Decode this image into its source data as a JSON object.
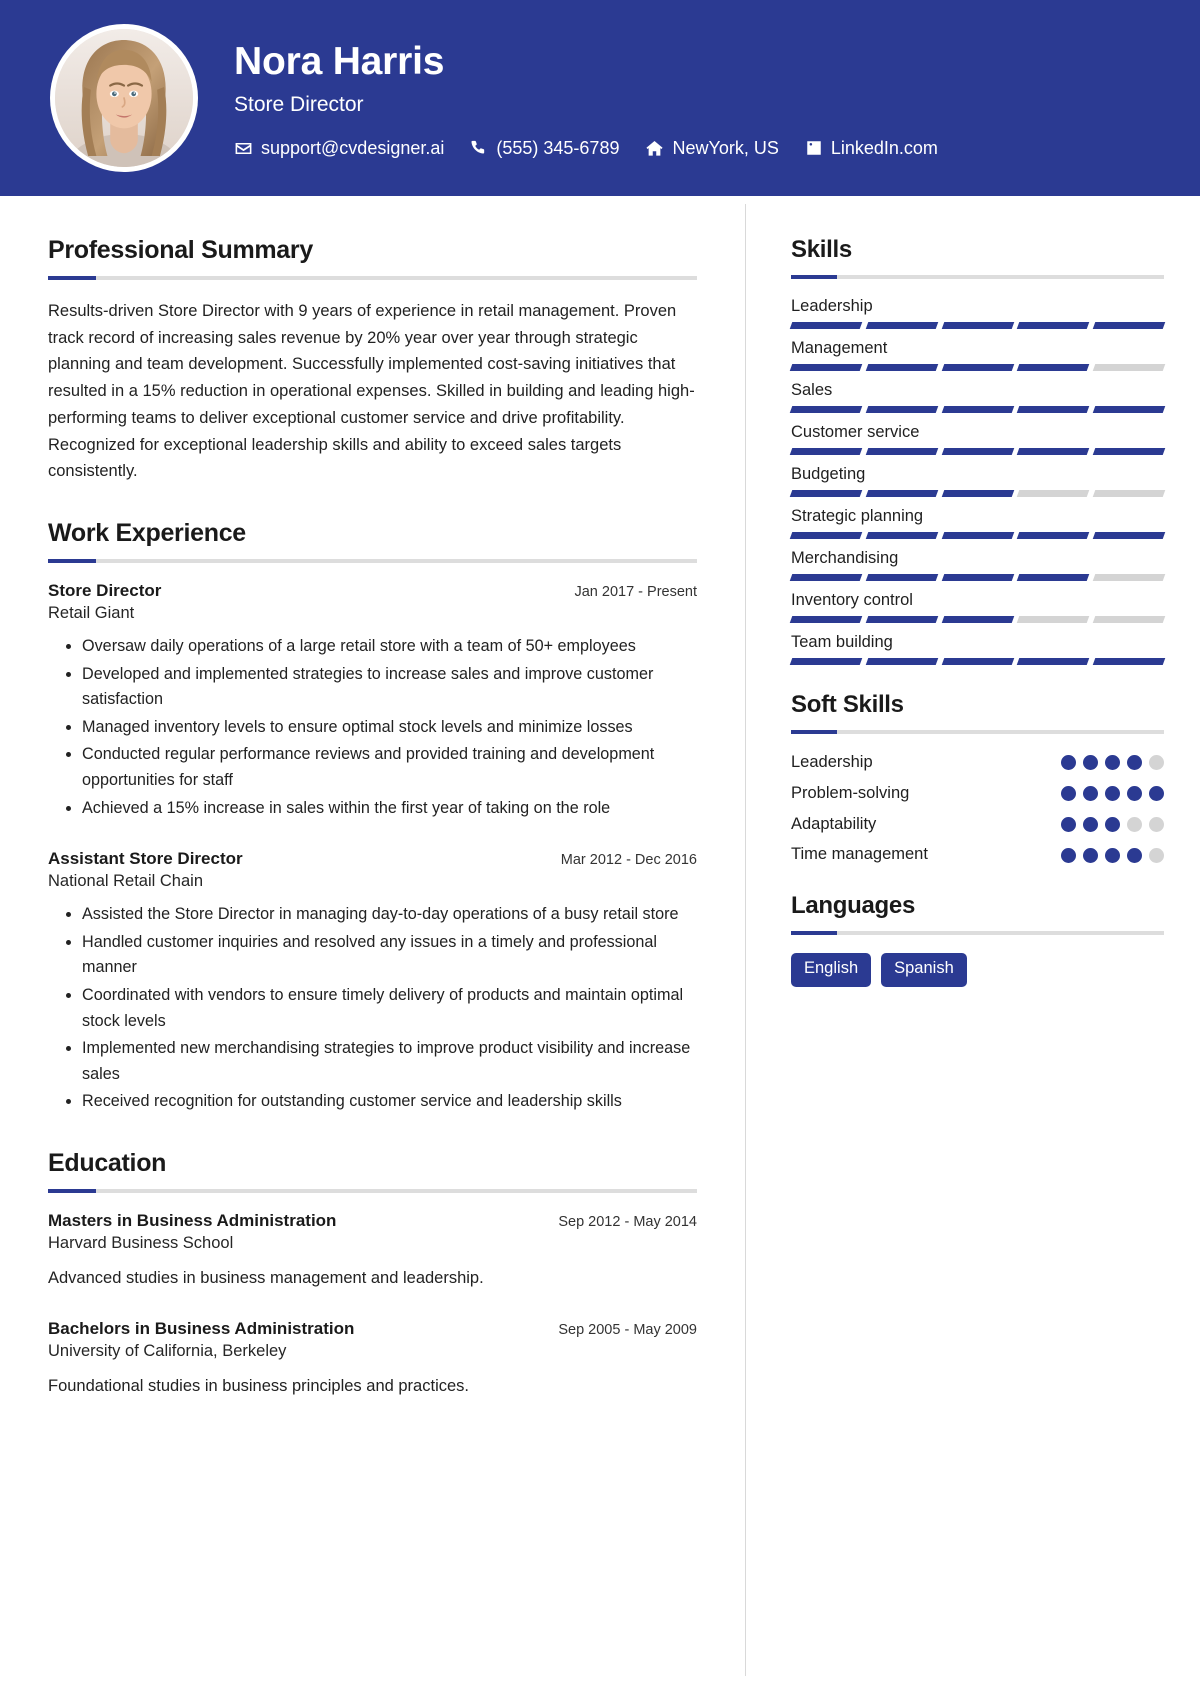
{
  "theme": {
    "accent": "#2B3A92",
    "track": "#d4d4d4",
    "rule": "#dddddd"
  },
  "header": {
    "name": "Nora Harris",
    "role": "Store Director",
    "contacts": [
      {
        "icon": "envelope-icon",
        "text": "support@cvdesigner.ai"
      },
      {
        "icon": "phone-icon",
        "text": "(555) 345-6789"
      },
      {
        "icon": "home-icon",
        "text": "NewYork, US"
      },
      {
        "icon": "linkedin-icon",
        "text": "LinkedIn.com"
      }
    ]
  },
  "summary": {
    "title": "Professional Summary",
    "text": "Results-driven Store Director with 9 years of experience in retail management. Proven track record of increasing sales revenue by 20% year over year through strategic planning and team development. Successfully implemented cost-saving initiatives that resulted in a 15% reduction in operational expenses. Skilled in building and leading high-performing teams to deliver exceptional customer service and drive profitability. Recognized for exceptional leadership skills and ability to exceed sales targets consistently."
  },
  "work": {
    "title": "Work Experience",
    "entries": [
      {
        "title": "Store Director",
        "date": "Jan 2017 - Present",
        "org": "Retail Giant",
        "bullets": [
          "Oversaw daily operations of a large retail store with a team of 50+ employees",
          "Developed and implemented strategies to increase sales and improve customer satisfaction",
          "Managed inventory levels to ensure optimal stock levels and minimize losses",
          "Conducted regular performance reviews and provided training and development opportunities for staff",
          "Achieved a 15% increase in sales within the first year of taking on the role"
        ]
      },
      {
        "title": "Assistant Store Director",
        "date": "Mar 2012 - Dec 2016",
        "org": "National Retail Chain",
        "bullets": [
          "Assisted the Store Director in managing day-to-day operations of a busy retail store",
          "Handled customer inquiries and resolved any issues in a timely and professional manner",
          "Coordinated with vendors to ensure timely delivery of products and maintain optimal stock levels",
          "Implemented new merchandising strategies to improve product visibility and increase sales",
          "Received recognition for outstanding customer service and leadership skills"
        ]
      }
    ]
  },
  "education": {
    "title": "Education",
    "entries": [
      {
        "title": "Masters in Business Administration",
        "date": "Sep 2012 - May 2014",
        "org": "Harvard Business School",
        "desc": "Advanced studies in business management and leadership."
      },
      {
        "title": "Bachelors in Business Administration",
        "date": "Sep 2005 - May 2009",
        "org": "University of California, Berkeley",
        "desc": "Foundational studies in business principles and practices."
      }
    ]
  },
  "skills": {
    "title": "Skills",
    "max": 5,
    "items": [
      {
        "name": "Leadership",
        "level": 5
      },
      {
        "name": "Management",
        "level": 4
      },
      {
        "name": "Sales",
        "level": 5
      },
      {
        "name": "Customer service",
        "level": 5
      },
      {
        "name": "Budgeting",
        "level": 3
      },
      {
        "name": "Strategic planning",
        "level": 5
      },
      {
        "name": "Merchandising",
        "level": 4
      },
      {
        "name": "Inventory control",
        "level": 3
      },
      {
        "name": "Team building",
        "level": 5
      }
    ]
  },
  "soft_skills": {
    "title": "Soft Skills",
    "max": 5,
    "items": [
      {
        "name": "Leadership",
        "level": 4
      },
      {
        "name": "Problem-solving",
        "level": 5
      },
      {
        "name": "Adaptability",
        "level": 3
      },
      {
        "name": "Time management",
        "level": 4
      }
    ]
  },
  "languages": {
    "title": "Languages",
    "items": [
      "English",
      "Spanish"
    ]
  }
}
